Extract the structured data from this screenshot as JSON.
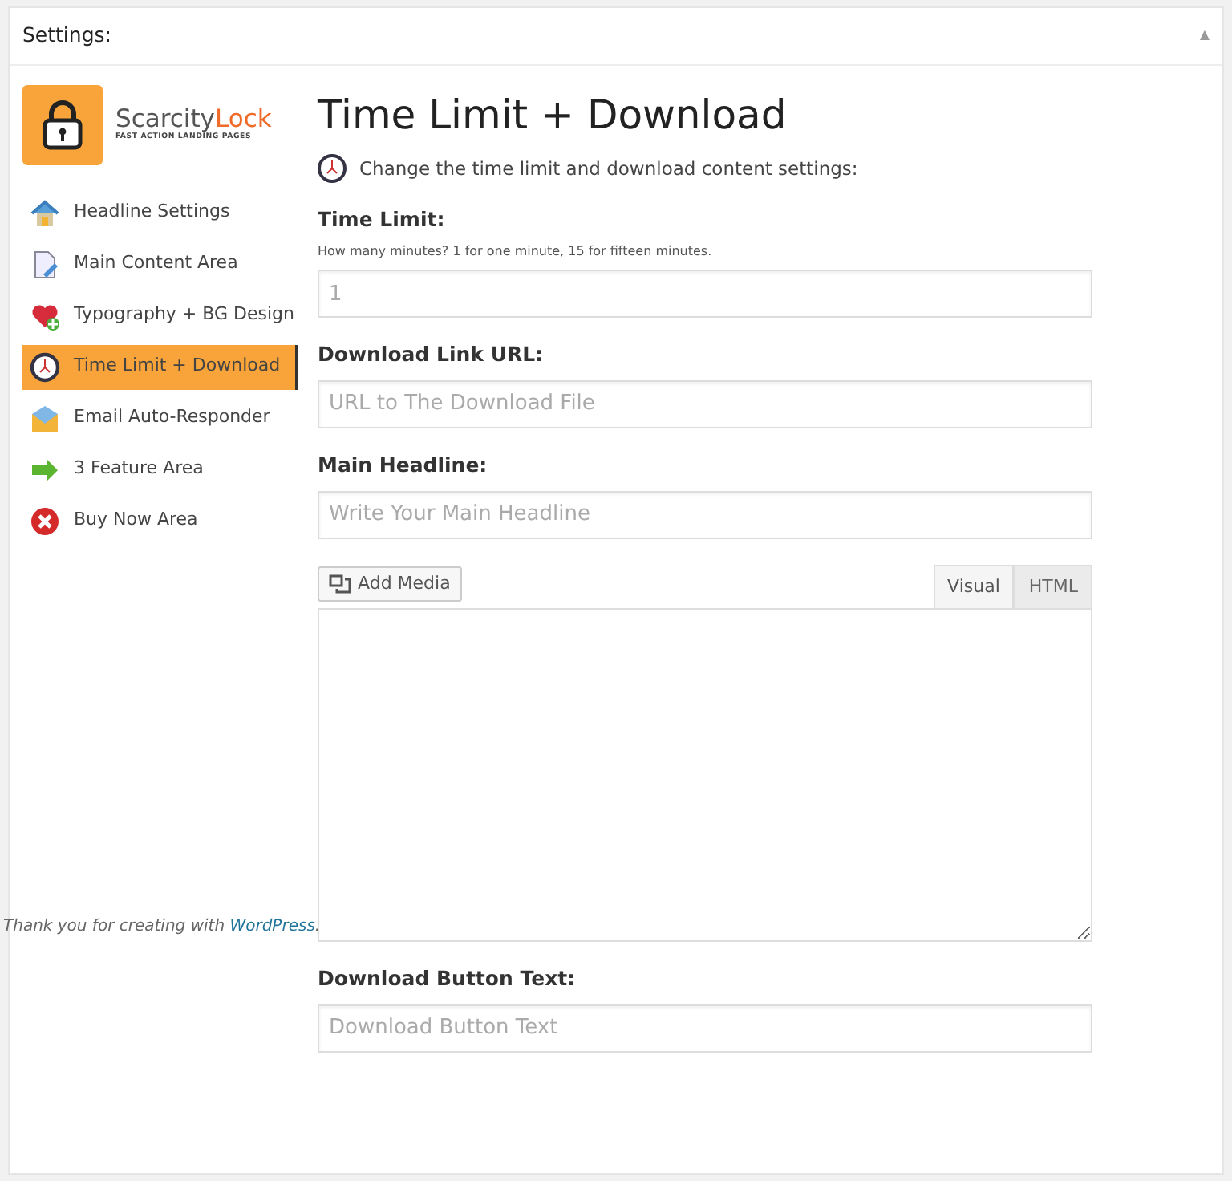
{
  "panel": {
    "title": "Settings:",
    "collapse_glyph": "▲"
  },
  "logo": {
    "name_plain": "Scarcity",
    "name_accent": "Lock",
    "tagline": "FAST ACTION LANDING PAGES"
  },
  "sidebar": {
    "items": [
      {
        "label": "Headline Settings",
        "kind": "home",
        "selected": false
      },
      {
        "label": "Main Content Area",
        "kind": "document",
        "selected": false
      },
      {
        "label": "Typography + BG Design",
        "kind": "heart",
        "selected": false
      },
      {
        "label": "Time Limit + Download",
        "kind": "clock",
        "selected": true
      },
      {
        "label": "Email Auto-Responder",
        "kind": "mail",
        "selected": false
      },
      {
        "label": "3 Feature Area",
        "kind": "arrow",
        "selected": false
      },
      {
        "label": "Buy Now Area",
        "kind": "close",
        "selected": false
      }
    ]
  },
  "footer": {
    "text": "Thank you for creating with",
    "link": "WordPress",
    "tail": "."
  },
  "heading": "Time Limit + Download",
  "intro": "Change the time limit and download content settings:",
  "fields": [
    {
      "label": "Time Limit:",
      "hint": "How many minutes? 1 for one minute, 15 for fifteen minutes.",
      "placeholder": "1"
    },
    {
      "label": "Download Link URL:",
      "placeholder": "URL to The Download File"
    },
    {
      "label": "Main Headline:",
      "placeholder": "Write Your Main Headline"
    }
  ],
  "editor": {
    "media_button": "Add Media",
    "tabs": [
      {
        "label": "Visual",
        "selected": true
      },
      {
        "label": "HTML",
        "selected": false
      }
    ]
  },
  "button_text_field": {
    "label": "Download Button Text:",
    "placeholder": "Download Button Text"
  }
}
